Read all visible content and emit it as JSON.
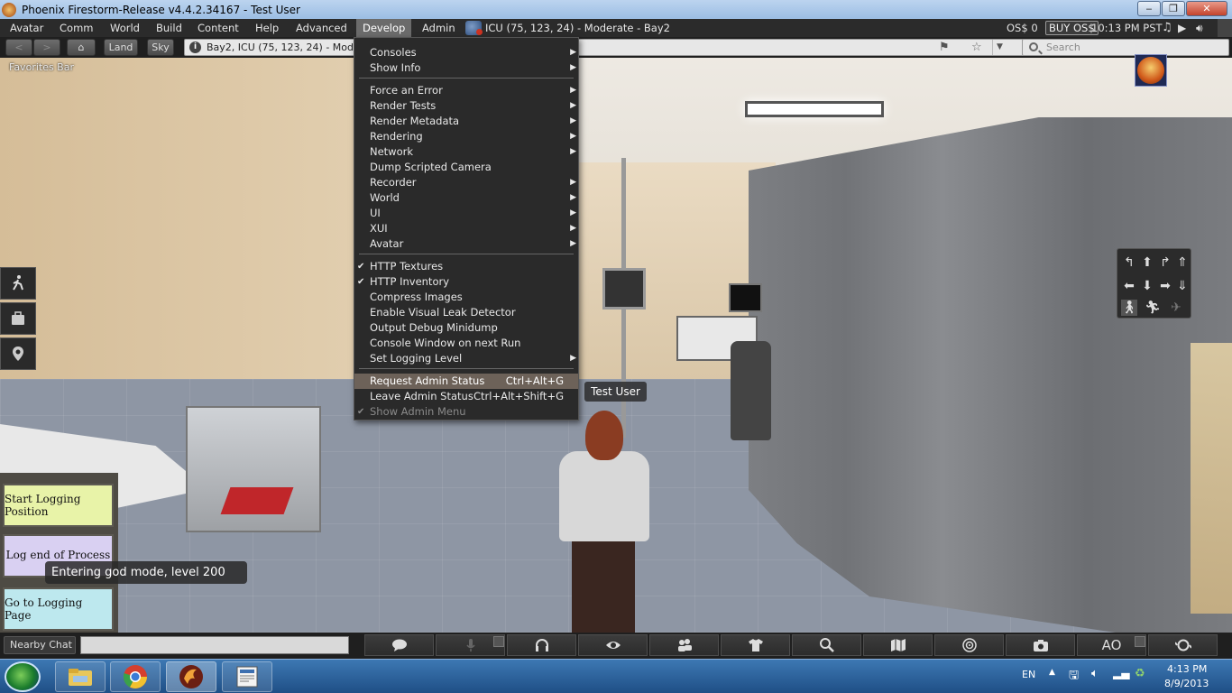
{
  "window": {
    "title": "Phoenix Firestorm-Release v4.4.2.34167 - Test User"
  },
  "menubar": {
    "items": [
      "Avatar",
      "Comm",
      "World",
      "Build",
      "Content",
      "Help",
      "Advanced",
      "Develop",
      "Admin"
    ],
    "parcel": "ICU (75, 123, 24) - Moderate - Bay2",
    "balance": "OS$ 0",
    "buy": "BUY OS$",
    "time": "10:13 PM PST"
  },
  "navbar": {
    "land": "Land",
    "sky": "Sky",
    "location": "Bay2, ICU (75, 123, 24) - Moderate",
    "search_placeholder": "Search",
    "favorites": "Favorites Bar"
  },
  "develop_menu": {
    "items": [
      {
        "label": "Consoles",
        "submenu": true
      },
      {
        "label": "Show Info",
        "submenu": true
      },
      {
        "label": "Force an Error",
        "submenu": true
      },
      {
        "label": "Render Tests",
        "submenu": true
      },
      {
        "label": "Render Metadata",
        "submenu": true
      },
      {
        "label": "Rendering",
        "submenu": true
      },
      {
        "label": "Network",
        "submenu": true
      },
      {
        "label": "Dump Scripted Camera"
      },
      {
        "label": "Recorder",
        "submenu": true
      },
      {
        "label": "World",
        "submenu": true
      },
      {
        "label": "UI",
        "submenu": true
      },
      {
        "label": "XUI",
        "submenu": true
      },
      {
        "label": "Avatar",
        "submenu": true
      },
      {
        "label": "HTTP Textures",
        "checked": true
      },
      {
        "label": "HTTP Inventory",
        "checked": true
      },
      {
        "label": "Compress Images"
      },
      {
        "label": "Enable Visual Leak Detector"
      },
      {
        "label": "Output Debug Minidump"
      },
      {
        "label": "Console Window on next Run"
      },
      {
        "label": "Set Logging Level",
        "submenu": true
      },
      {
        "label": "Request Admin Status",
        "shortcut": "Ctrl+Alt+G",
        "highlighted": true
      },
      {
        "label": "Leave Admin Status",
        "shortcut": "Ctrl+Alt+Shift+G"
      },
      {
        "label": "Show Admin Menu",
        "checked": true,
        "disabled": true
      }
    ],
    "check_glyph": "✔",
    "arrow_glyph": "▶"
  },
  "hud": {
    "start_logging": "Start Logging Position",
    "log_end": "Log end of Process",
    "go_logging": "Go to Logging Page",
    "colors": {
      "start": "#e8f3a8",
      "log_end": "#d9d0f2",
      "go": "#bde8ee"
    }
  },
  "notice": "Entering god mode, level 200",
  "nametag": "Test User",
  "bottombar": {
    "chat_label": "Nearby Chat",
    "ao": "AO",
    "buttons": [
      "chat-icon",
      "microphone-icon",
      "headphones-icon",
      "eye-icon",
      "people-icon",
      "shirt-icon",
      "search-icon",
      "map-icon",
      "minimap-icon",
      "camera-icon",
      "ao-button",
      "move-icon"
    ]
  },
  "taskbar": {
    "lang": "EN",
    "time": "4:13 PM",
    "date": "8/9/2013",
    "apps": [
      "file-explorer-icon",
      "chrome-icon",
      "firestorm-icon",
      "document-icon"
    ]
  }
}
